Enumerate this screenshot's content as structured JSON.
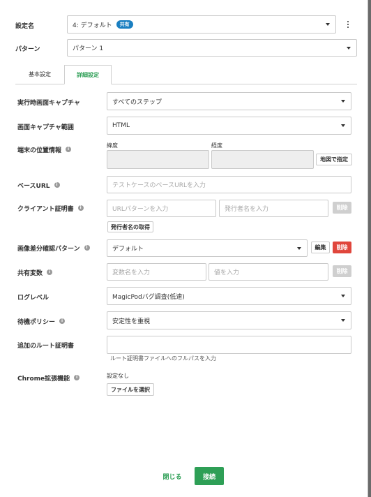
{
  "config_name": {
    "label": "設定名",
    "value": "4: デフォルト",
    "badge": "共有"
  },
  "pattern": {
    "label": "パターン",
    "value": "パターン 1"
  },
  "tabs": {
    "basic": "基本設定",
    "detail": "詳細設定"
  },
  "capture": {
    "label": "実行時画面キャプチャ",
    "value": "すべてのステップ"
  },
  "capture_range": {
    "label": "画面キャプチャ範囲",
    "value": "HTML"
  },
  "location": {
    "label": "端末の位置情報",
    "lat_label": "緯度",
    "lng_label": "経度",
    "map_button": "地図で指定"
  },
  "base_url": {
    "label": "ベースURL",
    "placeholder": "テストケースのベースURLを入力"
  },
  "client_cert": {
    "label": "クライアント証明書",
    "url_placeholder": "URLパターンを入力",
    "issuer_placeholder": "発行者名を入力",
    "delete": "削除",
    "fetch_issuer": "発行者名の取得"
  },
  "image_diff": {
    "label": "画像差分確認パターン",
    "value": "デフォルト",
    "edit": "編集",
    "delete": "削除"
  },
  "shared_vars": {
    "label": "共有変数",
    "name_placeholder": "変数名を入力",
    "value_placeholder": "値を入力",
    "delete": "削除"
  },
  "log_level": {
    "label": "ログレベル",
    "value": "MagicPodバグ調査(低速)"
  },
  "wait_policy": {
    "label": "待機ポリシー",
    "value": "安定性を重視"
  },
  "root_cert": {
    "label": "追加のルート証明書",
    "hint": "ルート証明書ファイルへのフルパスを入力"
  },
  "chrome_ext": {
    "label": "Chrome拡張機能",
    "status": "設定なし",
    "choose_file": "ファイルを選択"
  },
  "footer": {
    "close": "閉じる",
    "connect": "接続"
  },
  "colors": {
    "accent_green": "#2e9f56",
    "danger_red": "#e0463c",
    "badge_blue": "#1a7fc1"
  }
}
